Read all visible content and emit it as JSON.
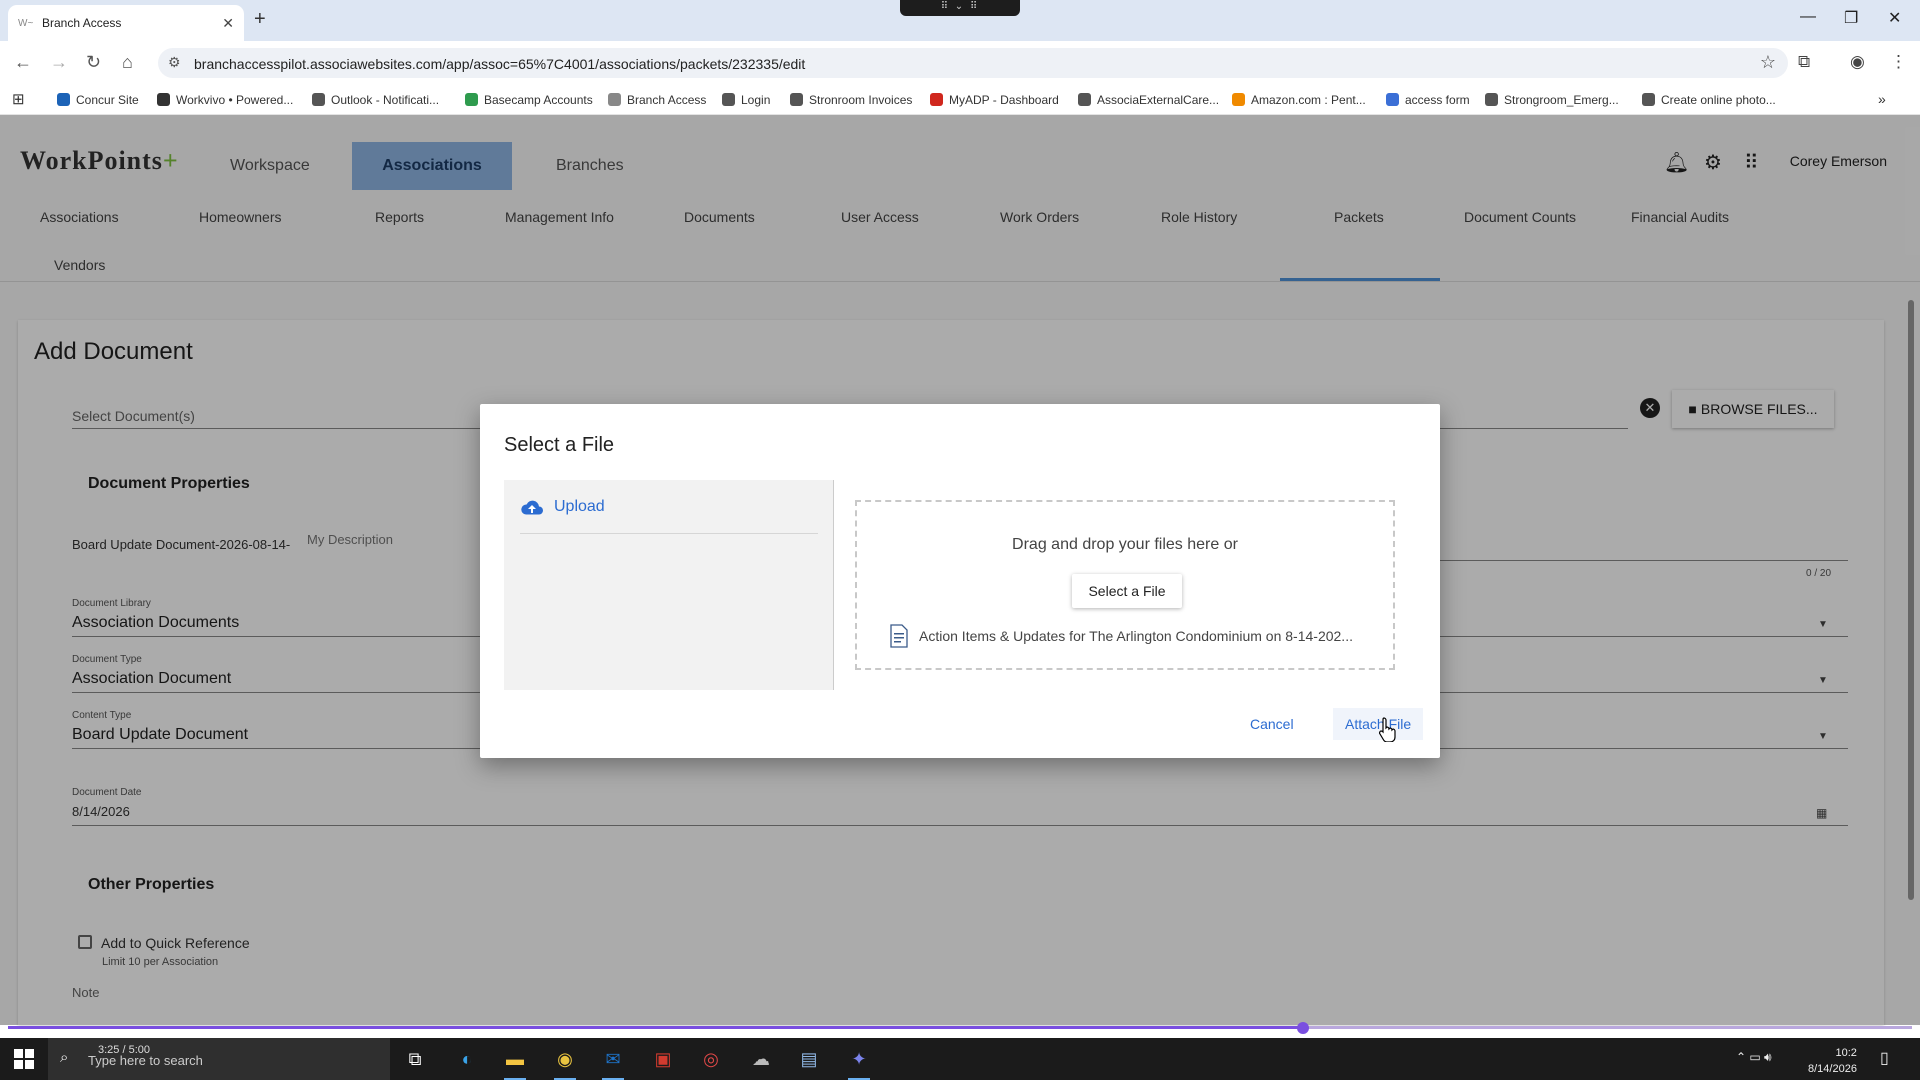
{
  "browser": {
    "tab_title": "Branch Access",
    "tab_favicon": "W~",
    "url": "branchaccesspilot.associawebsites.com/app/assoc=65%7C4001/associations/packets/232335/edit",
    "bookmarks": [
      {
        "label": "Concur Site",
        "color": "#1c63b7"
      },
      {
        "label": "Workvivo • Powered...",
        "color": "#333333"
      },
      {
        "label": "Outlook - Notificati...",
        "color": "#555555"
      },
      {
        "label": "Basecamp Accounts",
        "color": "#2e9b4e"
      },
      {
        "label": "Branch Access",
        "color": "#888888"
      },
      {
        "label": "Login",
        "color": "#555555"
      },
      {
        "label": "Stronroom Invoices",
        "color": "#555555"
      },
      {
        "label": "MyADP - Dashboard",
        "color": "#d0271d"
      },
      {
        "label": "AssociaExternalCare...",
        "color": "#555555"
      },
      {
        "label": "Amazon.com : Pent...",
        "color": "#f08a00"
      },
      {
        "label": "access form",
        "color": "#3b6fd6"
      },
      {
        "label": "Strongroom_Emerg...",
        "color": "#555555"
      },
      {
        "label": "Create online photo...",
        "color": "#555555"
      }
    ]
  },
  "app": {
    "logo_main": "WorkPoints",
    "logo_plus": "+",
    "top_nav": [
      "Workspace",
      "Associations",
      "Branches"
    ],
    "user_name": "Corey Emerson",
    "sub_nav": [
      "Associations",
      "Homeowners",
      "Reports",
      "Management Info",
      "Documents",
      "User Access",
      "Work Orders",
      "Role History",
      "Packets",
      "Document Counts",
      "Financial Audits",
      "Vendors"
    ],
    "active_sub_nav": "Packets"
  },
  "form": {
    "title": "Add Document",
    "select_placeholder": "Select Document(s)",
    "browse_label": "BROWSE FILES...",
    "doc_props_heading": "Document Properties",
    "doc_name_prefix": "Board Update Document-2026-08-14-",
    "description_placeholder": "My Description",
    "char_count": "0 / 20",
    "library_label": "Document Library",
    "library_value": "Association Documents",
    "type_label": "Document Type",
    "type_value": "Association Document",
    "content_label": "Content Type",
    "content_value": "Board Update Document",
    "date_label": "Document Date",
    "date_value": "8/14/2026",
    "other_props_heading": "Other Properties",
    "quick_ref_label": "Add to Quick Reference",
    "quick_ref_hint": "Limit 10 per Association",
    "note_label": "Note"
  },
  "dialog": {
    "title": "Select a File",
    "upload_label": "Upload",
    "drop_text": "Drag and drop your files here or",
    "select_button": "Select a File",
    "file_name": "Action Items & Updates for The Arlington Condominium on 8-14-202...",
    "cancel": "Cancel",
    "attach": "Attach File"
  },
  "media": {
    "time": "3:25 / 5:00",
    "progress": 0.68
  },
  "taskbar": {
    "search_placeholder": "Type here to search",
    "time": "10:2",
    "date": "8/14/2026"
  },
  "colors": {
    "accent_blue": "#2c6cd1",
    "nav_active": "#8fb7e4",
    "progress": "#7a4fe0"
  }
}
